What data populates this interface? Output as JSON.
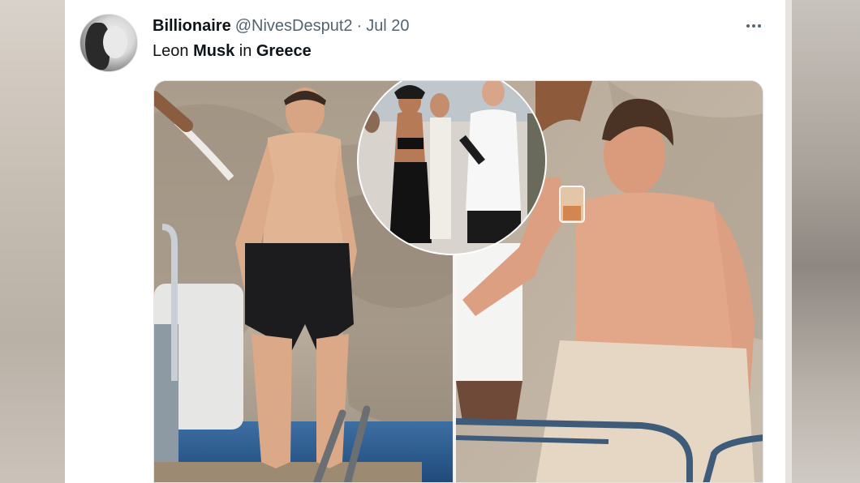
{
  "tweet": {
    "display_name": "Billionaire",
    "handle": "@NivesDesput2",
    "separator": "·",
    "date": "Jul 20",
    "text_parts": [
      "Leon ",
      "Musk",
      " in ",
      "Greece"
    ],
    "more_icon": "more-horizontal-icon"
  },
  "media": {
    "type": "photo-collage"
  },
  "colors": {
    "text_primary": "#0f1419",
    "text_secondary": "#536471",
    "card_bg": "#ffffff"
  }
}
